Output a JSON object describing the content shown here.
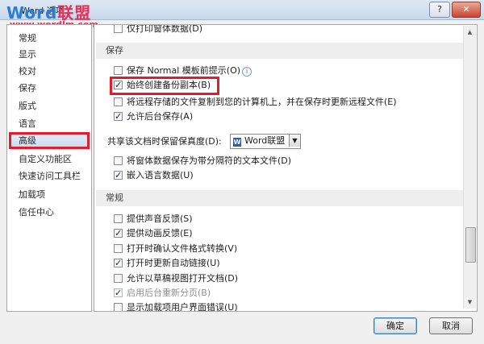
{
  "window": {
    "title": "Word 选项",
    "help_label": "?",
    "close_label": "✕"
  },
  "watermark": {
    "brand_en": "Word",
    "brand_cn": "联盟",
    "url": "www.wordlm.com"
  },
  "sidebar": {
    "items": [
      {
        "label": "常规"
      },
      {
        "label": "显示"
      },
      {
        "label": "校对"
      },
      {
        "label": "保存"
      },
      {
        "label": "版式"
      },
      {
        "label": "语言"
      },
      {
        "label": "高级",
        "active": true
      },
      {
        "label": "自定义功能区"
      },
      {
        "label": "快速访问工具栏"
      },
      {
        "label": "加载项"
      },
      {
        "label": "信任中心"
      }
    ]
  },
  "content": {
    "top_partial": {
      "label": "仅打印窗体数据(D)",
      "checked": false
    },
    "save_section": {
      "header": "保存",
      "options": [
        {
          "label": "保存 Normal 模板前提示(O)",
          "checked": false
        },
        {
          "label": "始终创建备份副本(B)",
          "checked": true
        },
        {
          "label": "将远程存储的文件复制到您的计算机上，并在保存时更新远程文件(E)",
          "checked": false
        },
        {
          "label": "允许后台保存(A)",
          "checked": true
        }
      ]
    },
    "fidelity": {
      "label": "共享该文档时保留保真度(D):",
      "doc_name": "Word联盟",
      "doc_icon": "W",
      "options": [
        {
          "label": "将窗体数据保存为带分隔符的文本文件(D)",
          "checked": false
        },
        {
          "label": "嵌入语言数据(U)",
          "checked": true
        }
      ]
    },
    "general_section": {
      "header": "常规",
      "options": [
        {
          "label": "提供声音反馈(S)",
          "checked": false,
          "disabled": false
        },
        {
          "label": "提供动画反馈(E)",
          "checked": true,
          "disabled": false
        },
        {
          "label": "打开时确认文件格式转换(V)",
          "checked": false,
          "disabled": false
        },
        {
          "label": "打开时更新自动链接(U)",
          "checked": true,
          "disabled": false
        },
        {
          "label": "允许以草稿视图打开文档(D)",
          "checked": false,
          "disabled": false
        },
        {
          "label": "启用后台重新分页(B)",
          "checked": true,
          "disabled": true
        },
        {
          "label": "显示加载项用户界面错误(U)",
          "checked": false,
          "disabled": false
        }
      ]
    }
  },
  "buttons": {
    "ok": "确定",
    "cancel": "取消"
  },
  "colors": {
    "highlight": "#e21c2b",
    "accent": "#3c7fb1"
  }
}
